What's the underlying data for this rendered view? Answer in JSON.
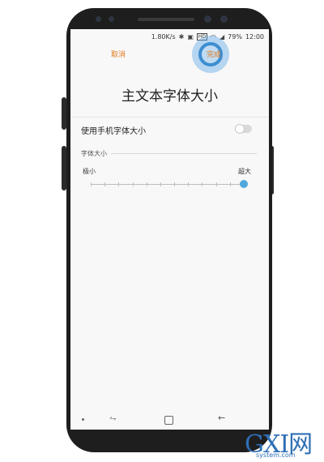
{
  "status_bar": {
    "speed": "1.80K/s",
    "hd": "HD",
    "battery": "79%",
    "time": "12:00"
  },
  "action_bar": {
    "cancel_label": "取消",
    "done_label": "完成"
  },
  "page_title": "主文本字体大小",
  "use_phone_font_size": {
    "label": "使用手机字体大小",
    "enabled": false
  },
  "font_size_section": {
    "title": "字体大小",
    "min_label": "极小",
    "max_label": "超大",
    "steps": 12,
    "selected_step": 12
  },
  "colors": {
    "accent": "#e07a1d",
    "slider_thumb": "#4fa9dd"
  },
  "watermark": {
    "logo": "GXI网",
    "site": "system.com"
  }
}
